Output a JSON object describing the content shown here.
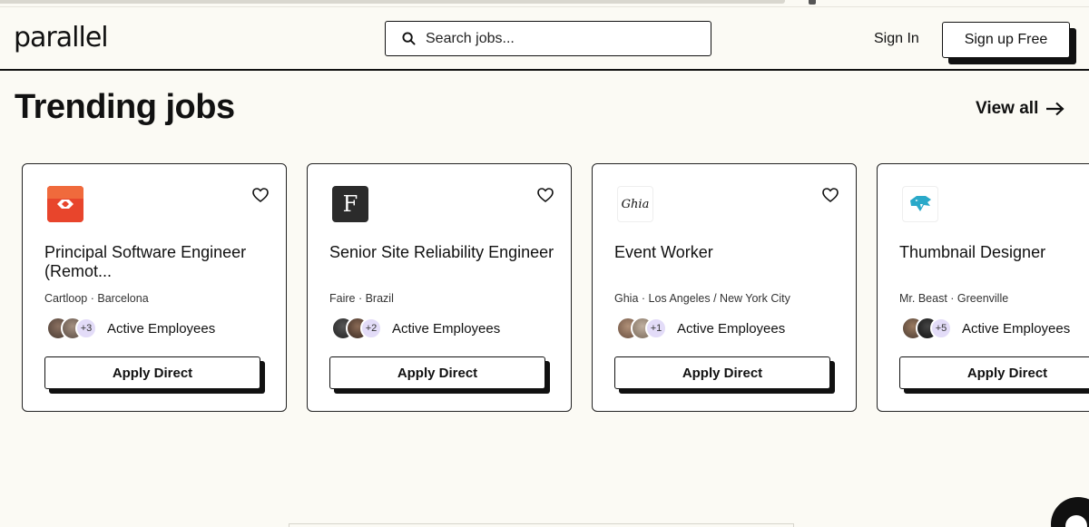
{
  "brand": {
    "logo": "parallel"
  },
  "header": {
    "search_placeholder": "Search jobs...",
    "signin_label": "Sign In",
    "signup_label": "Sign up Free"
  },
  "section": {
    "title": "Trending jobs",
    "view_all_label": "View all"
  },
  "jobs": [
    {
      "company_logo_letter": "",
      "logo_color": "#e8452c",
      "title": "Principal Software Engineer (Remot...",
      "meta": "Cartloop · Barcelona",
      "employee_count": "+3",
      "employees_label": "Active Employees",
      "apply_label": "Apply Direct"
    },
    {
      "company_logo_letter": "F",
      "logo_color": "#2b2b2b",
      "title": "Senior Site Reliability Engineer",
      "meta": "Faire · Brazil",
      "employee_count": "+2",
      "employees_label": "Active Employees",
      "apply_label": "Apply Direct"
    },
    {
      "company_logo_letter": "Ghia",
      "logo_color": "#ffffff",
      "title": "Event Worker",
      "meta": "Ghia · Los Angeles / New York City",
      "employee_count": "+1",
      "employees_label": "Active Employees",
      "apply_label": "Apply Direct"
    },
    {
      "company_logo_letter": "",
      "logo_color": "#2aa9c9",
      "title": "Thumbnail Designer",
      "meta": "Mr. Beast · Greenville",
      "employee_count": "+5",
      "employees_label": "Active Employees",
      "apply_label": "Apply Direct"
    }
  ],
  "colors": {
    "background": "#fbfaf4",
    "accent": "#111111",
    "count_badge": "#e3dcf8"
  }
}
